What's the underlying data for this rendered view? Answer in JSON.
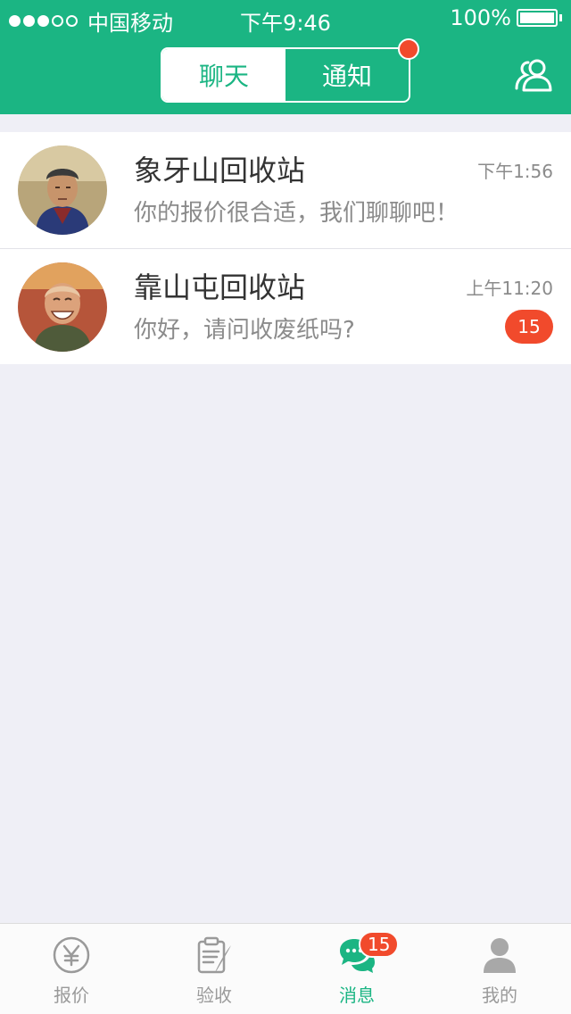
{
  "status_bar": {
    "carrier": "中国移动",
    "time": "下午9:46",
    "battery": "100%",
    "signal_bars_filled": 3,
    "signal_bars_total": 5
  },
  "header": {
    "tabs": [
      {
        "label": "聊天",
        "active": true
      },
      {
        "label": "通知",
        "active": false,
        "has_dot": true
      }
    ],
    "right_icon": "contacts-icon"
  },
  "conversations": [
    {
      "name": "象牙山回收站",
      "message": "你的报价很合适，我们聊聊吧！",
      "time": "下午1:56",
      "avatar": "avatar-photo"
    },
    {
      "name": "靠山屯回收站",
      "message": "你好，请问收废纸吗?",
      "time": "上午11:20",
      "badge": "15",
      "avatar": "avatar-photo"
    }
  ],
  "tabbar": {
    "items": [
      {
        "label": "报价",
        "icon": "yen-icon",
        "active": false
      },
      {
        "label": "验收",
        "icon": "clipboard-icon",
        "active": false
      },
      {
        "label": "消息",
        "icon": "chat-bubbles-icon",
        "active": true,
        "badge": "15"
      },
      {
        "label": "我的",
        "icon": "person-icon",
        "active": false
      }
    ]
  },
  "colors": {
    "primary": "#1bb583",
    "badge": "#f14a2c",
    "background": "#efeff6"
  }
}
